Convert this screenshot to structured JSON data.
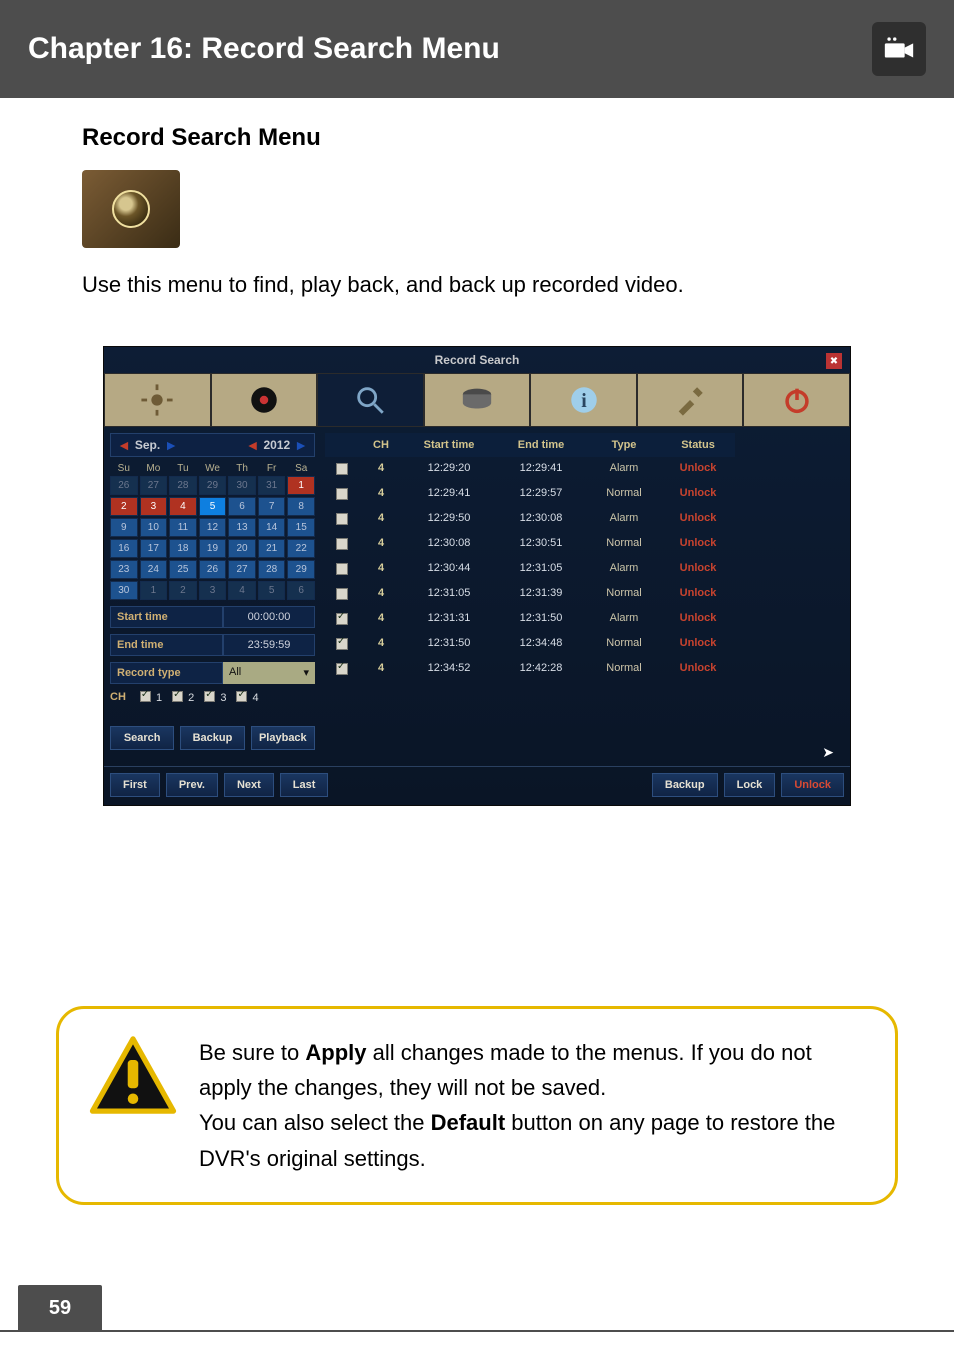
{
  "chapter_title": "Chapter 16: Record Search Menu",
  "section_title": "Record Search Menu",
  "intro_text": "Use this menu to find, play back, and back up recorded video.",
  "screenshot": {
    "title": "Record Search",
    "month_nav": {
      "month": "Sep.",
      "year": "2012"
    },
    "dow": [
      "Su",
      "Mo",
      "Tu",
      "We",
      "Th",
      "Fr",
      "Sa"
    ],
    "cal_rows": [
      [
        {
          "d": "26",
          "c": "dim"
        },
        {
          "d": "27",
          "c": "dim"
        },
        {
          "d": "28",
          "c": "dim"
        },
        {
          "d": "29",
          "c": "dim"
        },
        {
          "d": "30",
          "c": "dim"
        },
        {
          "d": "31",
          "c": "dim"
        },
        {
          "d": "1",
          "c": "red"
        }
      ],
      [
        {
          "d": "2",
          "c": "red"
        },
        {
          "d": "3",
          "c": "red"
        },
        {
          "d": "4",
          "c": "red"
        },
        {
          "d": "5",
          "c": "sel"
        },
        {
          "d": "6",
          "c": "mark"
        },
        {
          "d": "7",
          "c": "mark"
        },
        {
          "d": "8",
          "c": "mark"
        }
      ],
      [
        {
          "d": "9",
          "c": "mark"
        },
        {
          "d": "10",
          "c": "mark"
        },
        {
          "d": "11",
          "c": "mark"
        },
        {
          "d": "12",
          "c": "mark"
        },
        {
          "d": "13",
          "c": "mark"
        },
        {
          "d": "14",
          "c": "mark"
        },
        {
          "d": "15",
          "c": "mark"
        }
      ],
      [
        {
          "d": "16",
          "c": "mark"
        },
        {
          "d": "17",
          "c": "mark"
        },
        {
          "d": "18",
          "c": "mark"
        },
        {
          "d": "19",
          "c": "mark"
        },
        {
          "d": "20",
          "c": "mark"
        },
        {
          "d": "21",
          "c": "mark"
        },
        {
          "d": "22",
          "c": "mark"
        }
      ],
      [
        {
          "d": "23",
          "c": "mark"
        },
        {
          "d": "24",
          "c": "mark"
        },
        {
          "d": "25",
          "c": "mark"
        },
        {
          "d": "26",
          "c": "mark"
        },
        {
          "d": "27",
          "c": "mark"
        },
        {
          "d": "28",
          "c": "mark"
        },
        {
          "d": "29",
          "c": "mark"
        }
      ],
      [
        {
          "d": "30",
          "c": "mark"
        },
        {
          "d": "1",
          "c": "dim"
        },
        {
          "d": "2",
          "c": "dim"
        },
        {
          "d": "3",
          "c": "dim"
        },
        {
          "d": "4",
          "c": "dim"
        },
        {
          "d": "5",
          "c": "dim"
        },
        {
          "d": "6",
          "c": "dim"
        }
      ]
    ],
    "fields": {
      "start_time_label": "Start time",
      "start_time_val": "00:00:00",
      "end_time_label": "End time",
      "end_time_val": "23:59:59",
      "record_type_label": "Record type",
      "record_type_val": "All"
    },
    "ch_label": "CH",
    "ch_options": [
      "1",
      "2",
      "3",
      "4"
    ],
    "left_buttons": {
      "search": "Search",
      "backup": "Backup",
      "playback": "Playback"
    },
    "headers": {
      "ch": "CH",
      "start": "Start time",
      "end": "End time",
      "type": "Type",
      "status": "Status"
    },
    "rows": [
      {
        "chk": false,
        "ch": "4",
        "start": "12:29:20",
        "end": "12:29:41",
        "type": "Alarm",
        "status": "Unlock",
        "cls": ""
      },
      {
        "chk": false,
        "ch": "4",
        "start": "12:29:41",
        "end": "12:29:57",
        "type": "Normal",
        "status": "Unlock",
        "cls": ""
      },
      {
        "chk": false,
        "ch": "4",
        "start": "12:29:50",
        "end": "12:30:08",
        "type": "Alarm",
        "status": "Unlock",
        "cls": ""
      },
      {
        "chk": false,
        "ch": "4",
        "start": "12:30:08",
        "end": "12:30:51",
        "type": "Normal",
        "status": "Unlock",
        "cls": ""
      },
      {
        "chk": false,
        "ch": "4",
        "start": "12:30:44",
        "end": "12:31:05",
        "type": "Alarm",
        "status": "Unlock",
        "cls": ""
      },
      {
        "chk": false,
        "ch": "4",
        "start": "12:31:05",
        "end": "12:31:39",
        "type": "Normal",
        "status": "Unlock",
        "cls": ""
      },
      {
        "chk": true,
        "ch": "4",
        "start": "12:31:31",
        "end": "12:31:50",
        "type": "Alarm",
        "status": "Unlock",
        "cls": ""
      },
      {
        "chk": true,
        "ch": "4",
        "start": "12:31:50",
        "end": "12:34:48",
        "type": "Normal",
        "status": "Unlock",
        "cls": ""
      },
      {
        "chk": true,
        "ch": "4",
        "start": "12:34:52",
        "end": "12:42:28",
        "type": "Normal",
        "status": "Unlock",
        "cls": "row-sel row-hi"
      }
    ],
    "footer": {
      "first": "First",
      "prev": "Prev.",
      "next": "Next",
      "last": "Last",
      "backup": "Backup",
      "lock": "Lock",
      "unlock": "Unlock"
    }
  },
  "warning": {
    "p1a": "Be sure to ",
    "p1b": "Apply",
    "p1c": " all changes made to the menus. If you do not apply the changes, they will not be saved.",
    "p2a": "You can also select the ",
    "p2b": "Default",
    "p2c": " button on any page to restore the DVR's original settings."
  },
  "page_number": "59"
}
